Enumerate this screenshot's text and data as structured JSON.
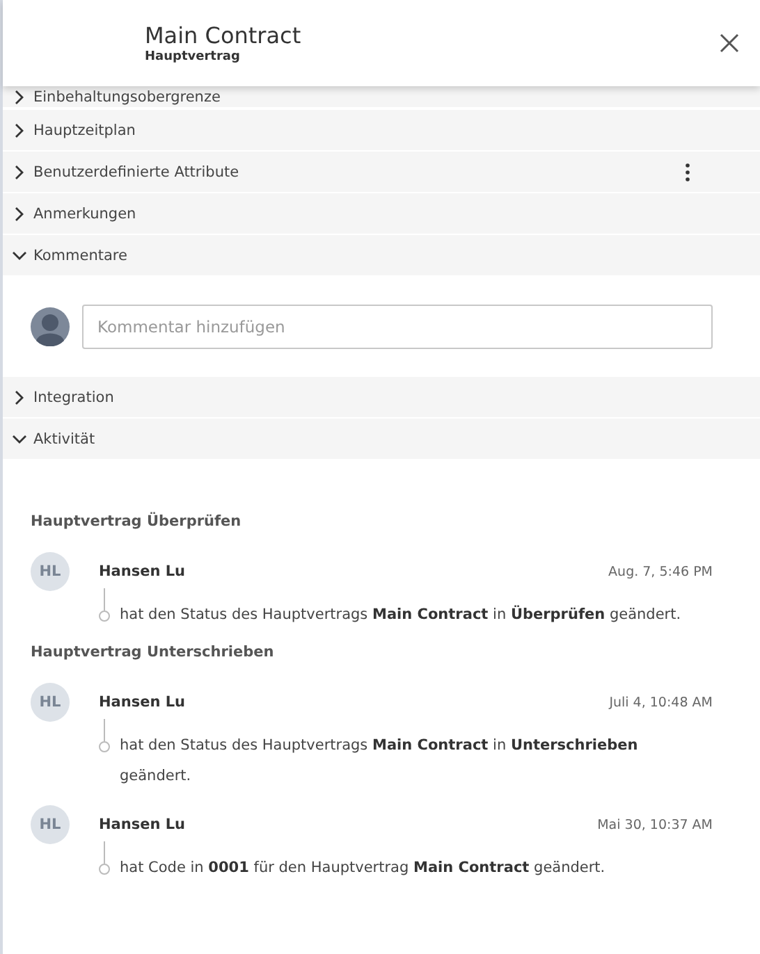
{
  "header": {
    "title": "Main Contract",
    "subtitle": "Hauptvertrag"
  },
  "sections": [
    {
      "label": "Einbehaltungsobergrenze",
      "expanded": false,
      "clipped": true
    },
    {
      "label": "Hauptzeitplan",
      "expanded": false
    },
    {
      "label": "Benutzerdefinierte Attribute",
      "expanded": false,
      "menu": true
    },
    {
      "label": "Anmerkungen",
      "expanded": false
    },
    {
      "label": "Kommentare",
      "expanded": true,
      "kind": "comments"
    },
    {
      "label": "Integration",
      "expanded": false
    },
    {
      "label": "Aktivität",
      "expanded": true,
      "kind": "activity"
    }
  ],
  "comment_box": {
    "placeholder": "Kommentar hinzufügen"
  },
  "activity": [
    {
      "title": "Hauptvertrag Überprüfen",
      "entries": [
        {
          "initials": "HL",
          "user": "Hansen Lu",
          "time": "Aug. 7, 5:46 PM",
          "text": "hat den Status des Hauptvertrags **Main Contract** in **Überprüfen** geändert."
        }
      ]
    },
    {
      "title": "Hauptvertrag Unterschrieben",
      "entries": [
        {
          "initials": "HL",
          "user": "Hansen Lu",
          "time": "Juli 4, 10:48 AM",
          "text": "hat den Status des Hauptvertrags **Main Contract** in **Unterschrieben** geändert."
        },
        {
          "initials": "HL",
          "user": "Hansen Lu",
          "time": "Mai 30, 10:37 AM",
          "text": "hat Code in **0001** für den Hauptvertrag **Main Contract** geändert."
        }
      ]
    }
  ]
}
